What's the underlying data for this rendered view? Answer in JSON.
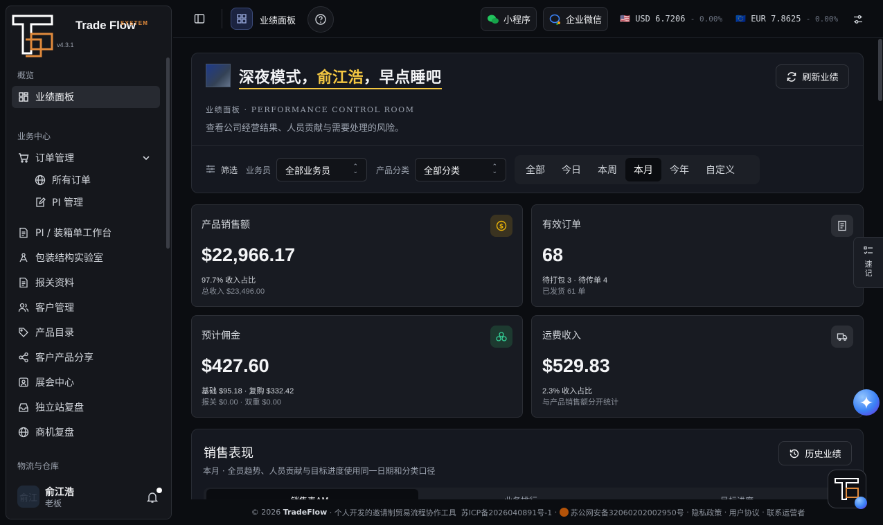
{
  "sidebar": {
    "brand": "Trade Flow",
    "system": "SYSTEM",
    "version": "v4.3.1",
    "sections": {
      "overview": "概览",
      "business": "业务中心",
      "logistics": "物流与仓库"
    },
    "items": {
      "dashboard": "业绩面板",
      "orders": "订单管理",
      "all_orders": "所有订单",
      "pi_manage": "PI 管理",
      "pi_workbench": "PI / 装箱单工作台",
      "packaging_lab": "包装结构实验室",
      "customs": "报关资料",
      "customers": "客户管理",
      "catalog": "产品目录",
      "share": "客户产品分享",
      "exhibition": "展会中心",
      "site_review": "独立站复盘",
      "opportunity": "商机复盘"
    },
    "user": {
      "name": "俞江浩",
      "role": "老板",
      "avatar_text": "俞江"
    }
  },
  "topbar": {
    "page_label": "业绩面板",
    "mini_program": "小程序",
    "wecom": "企业微信",
    "usd": {
      "flag": "🇺🇸",
      "code": "USD",
      "rate": "6.7206",
      "change": "- 0.00%"
    },
    "eur": {
      "flag": "🇪🇺",
      "code": "EUR",
      "rate": "7.8625",
      "change": "- 0.00%"
    }
  },
  "hero": {
    "greet_pre": "深夜模式，",
    "greet_name": "俞江浩",
    "greet_post": "，早点睡吧",
    "refresh": "刷新业绩",
    "eyebrow": "业绩面板 · PERFORMANCE CONTROL ROOM",
    "description": "查看公司经营结果、人员贡献与需要处理的风险。"
  },
  "filters": {
    "label": "筛选",
    "salesperson_label": "业务员",
    "salesperson_value": "全部业务员",
    "category_label": "产品分类",
    "category_value": "全部分类",
    "periods": [
      "全部",
      "今日",
      "本周",
      "本月",
      "今年",
      "自定义"
    ],
    "active_period": "本月"
  },
  "cards": {
    "sales": {
      "title": "产品销售额",
      "value": "$22,966.17",
      "line1": "97.7% 收入占比",
      "line2": "总收入 $23,496.00"
    },
    "orders": {
      "title": "有效订单",
      "value": "68",
      "line1": "待打包 3 · 待传单 4",
      "line2": "已发货 61 单"
    },
    "commission": {
      "title": "预计佣金",
      "value": "$427.60",
      "line1": "基础 $95.18 · 复购 $332.42",
      "line2": "报关 $0.00 · 双重 $0.00"
    },
    "freight": {
      "title": "运费收入",
      "value": "$529.83",
      "line1": "2.3% 收入占比",
      "line2": "与产品销售额分开统计"
    }
  },
  "sales_panel": {
    "title": "销售表现",
    "subtitle": "本月 · 全员趋势、人员贡献与目标进度使用同一日期和分类口径",
    "history": "历史业绩",
    "tabs": [
      "销售表AM",
      "业务排行",
      "目标进度"
    ]
  },
  "side_note": {
    "chars": [
      "速",
      "记"
    ]
  },
  "footer": {
    "copyright": "© 2026",
    "brand": "TradeFlow",
    "tagline": "· 个人开发的邀请制贸易流程协作工具",
    "icp": "苏ICP备2026040891号-1",
    "police": "苏公网安备32060202002950号",
    "privacy": "隐私政策",
    "terms": "用户协议",
    "contact": "联系运营者"
  },
  "colors": {
    "accent_gold": "#f5c842",
    "brand_orange": "#e08a3c",
    "bg": "#0b0d11"
  }
}
